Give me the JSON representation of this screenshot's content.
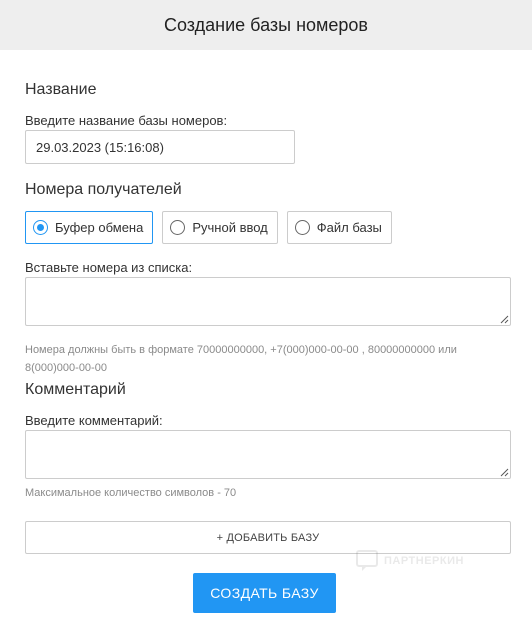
{
  "header": {
    "title": "Создание базы номеров"
  },
  "name_section": {
    "title": "Название",
    "label": "Введите название базы номеров:",
    "value": "29.03.2023 (15:16:08)"
  },
  "recipients_section": {
    "title": "Номера получателей",
    "options": [
      {
        "label": "Буфер обмена",
        "selected": true
      },
      {
        "label": "Ручной ввод",
        "selected": false
      },
      {
        "label": "Файл базы",
        "selected": false
      }
    ],
    "paste_label": "Вставьте номера из списка:",
    "paste_value": "",
    "hint": "Номера должны быть в формате 70000000000, +7(000)000-00-00 , 80000000000 или 8(000)000-00-00"
  },
  "comment_section": {
    "title": "Комментарий",
    "label": "Введите комментарий:",
    "value": "",
    "hint": "Максимальное количество символов - 70"
  },
  "buttons": {
    "add_label": "+ ДОБАВИТЬ БАЗУ",
    "create_label": "СОЗДАТЬ БАЗУ"
  },
  "watermark": {
    "text": "ПАРТНЕРКИН"
  },
  "colors": {
    "accent": "#2196f3",
    "header_bg": "#eeeeee",
    "border": "#cccccc",
    "hint": "#8a8a8a"
  }
}
